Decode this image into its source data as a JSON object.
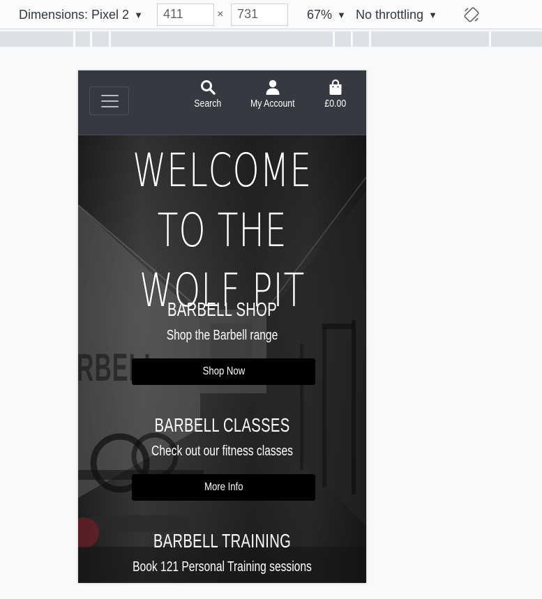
{
  "devtools": {
    "dimensions_label": "Dimensions: Pixel 2",
    "width": "411",
    "times": "×",
    "height": "731",
    "zoom": "67%",
    "throttling": "No throttling"
  },
  "site": {
    "nav": {
      "search_label": "Search",
      "account_label": "My Account",
      "bag_label": "£0.00"
    },
    "hero": {
      "title": "WELCOME TO THE WOLF PIT",
      "wall_text": "RBELL",
      "shop": {
        "heading": "BARBELL SHOP",
        "text": "Shop the Barbell range",
        "button": "Shop Now"
      },
      "classes": {
        "heading": "BARBELL CLASSES",
        "text": "Check out our fitness classes",
        "button": "More Info"
      },
      "training": {
        "heading": "BARBELL TRAINING",
        "text": "Book 121 Personal Training sessions"
      }
    }
  }
}
